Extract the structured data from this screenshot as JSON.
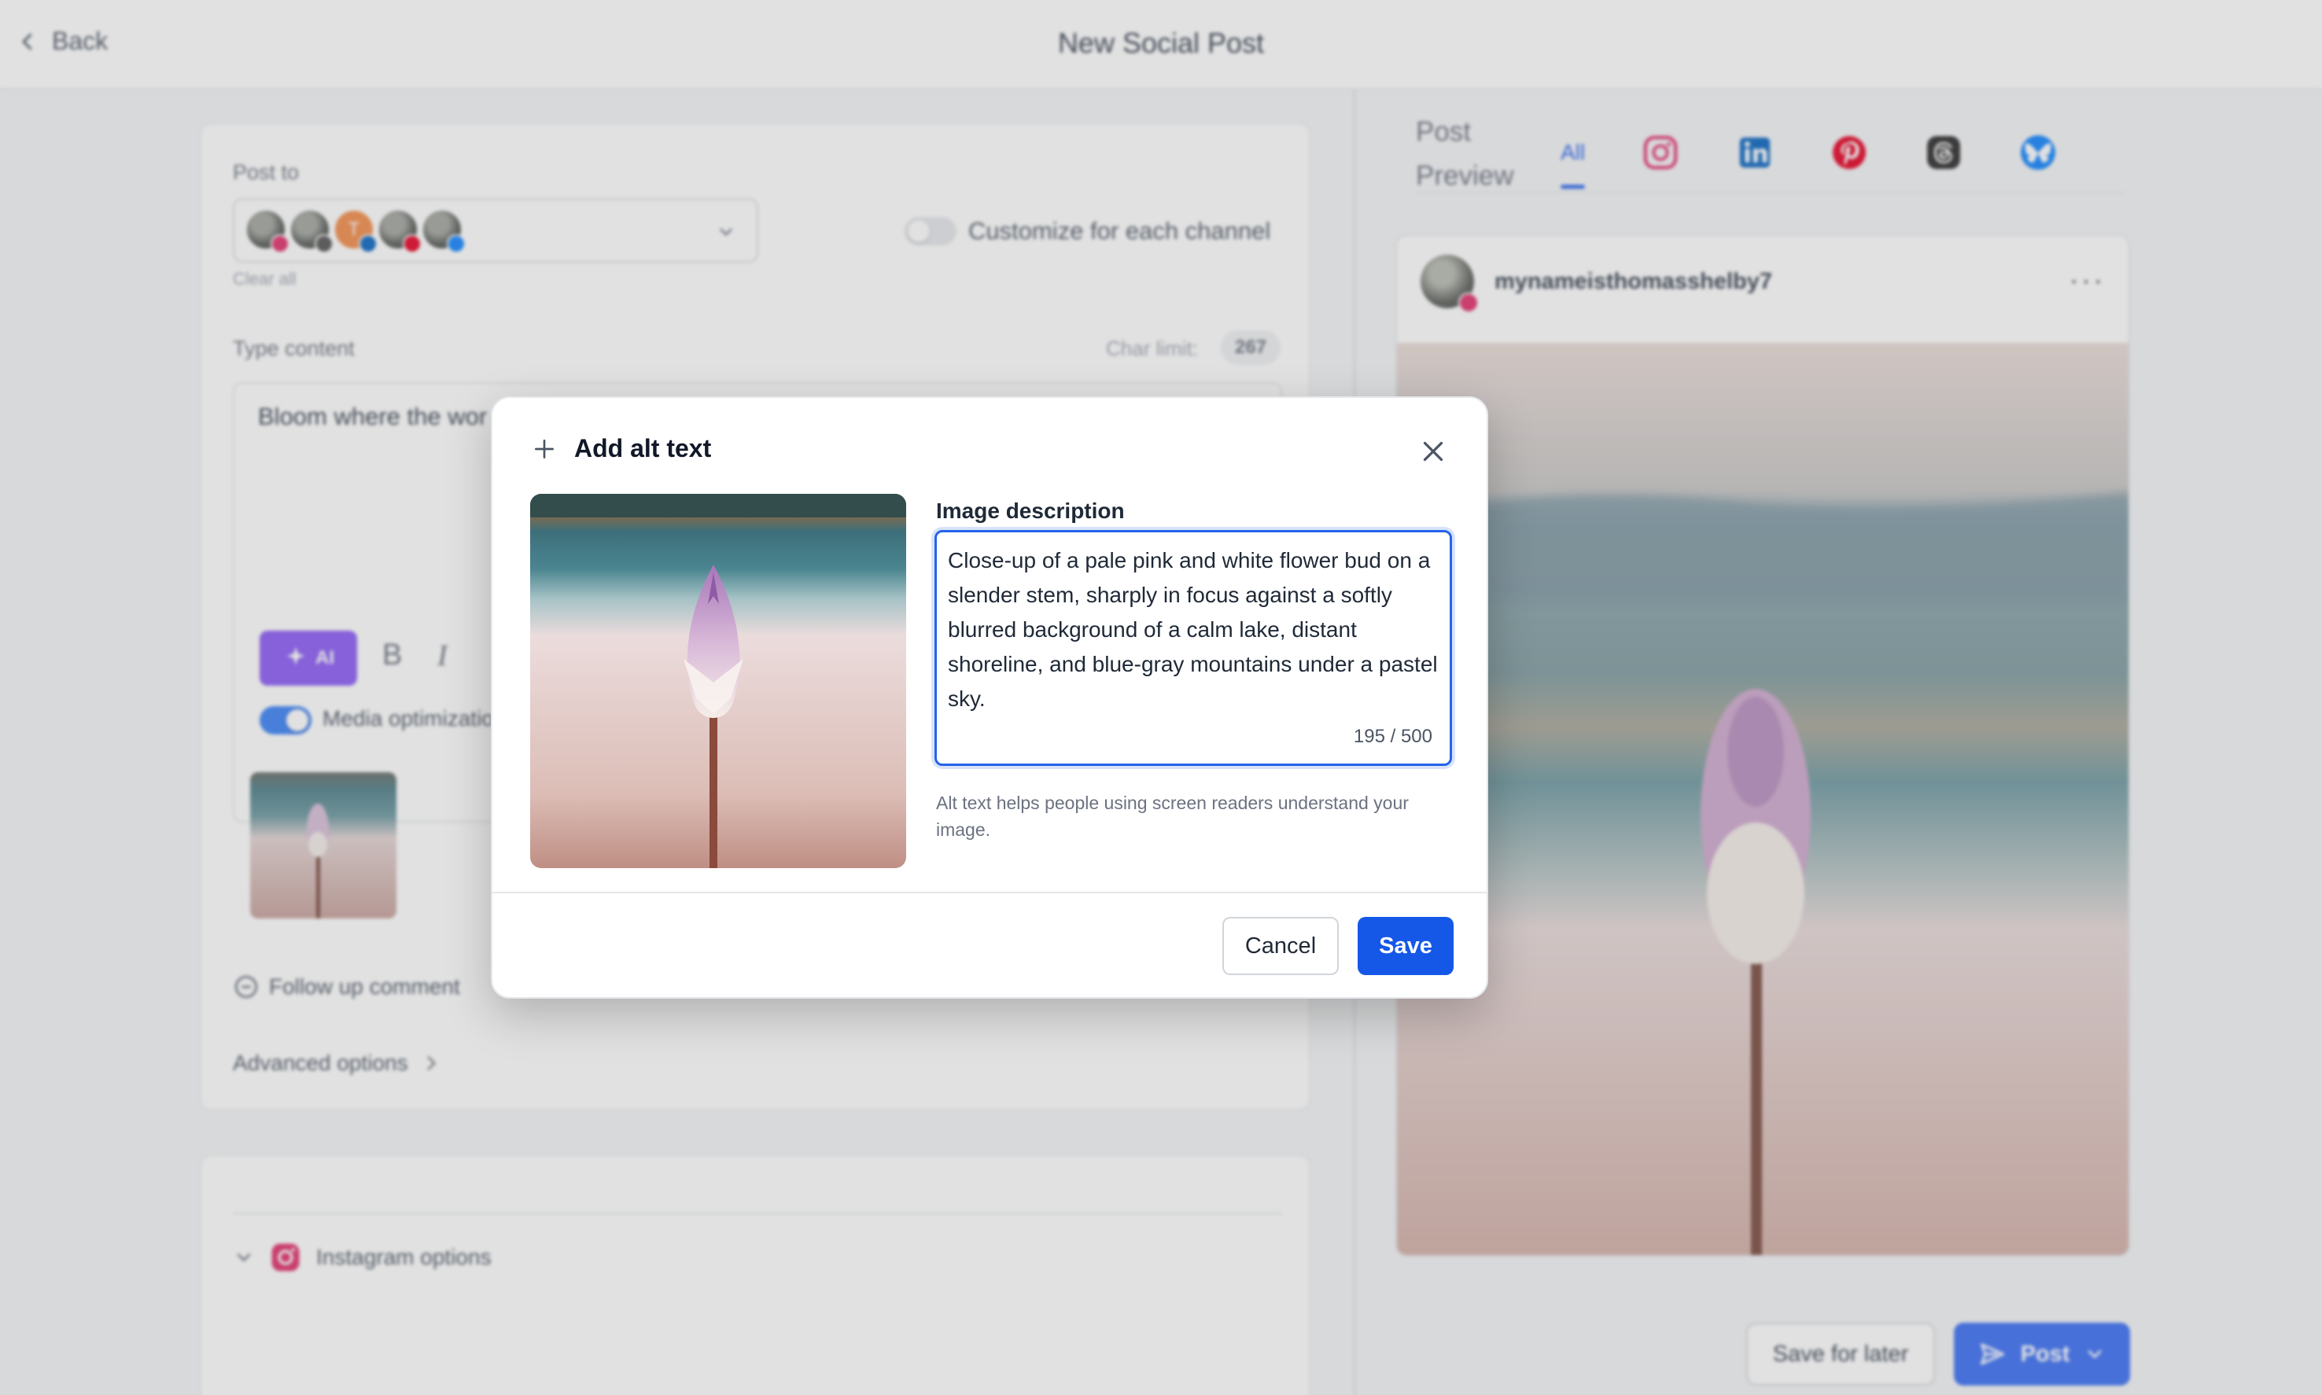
{
  "header": {
    "back_label": "Back",
    "title": "New Social Post"
  },
  "composer": {
    "post_to_label": "Post to",
    "channels": [
      {
        "name": "instagram",
        "badge": "#e1306c"
      },
      {
        "name": "threads",
        "badge": "#555555"
      },
      {
        "name": "linkedin",
        "badge": "#0a66c2",
        "initial": "T"
      },
      {
        "name": "pinterest",
        "badge": "#e60023"
      },
      {
        "name": "bluesky",
        "badge": "#1185fe"
      }
    ],
    "clear_all": "Clear all",
    "customize_label": "Customize for each channel",
    "type_content_label": "Type content",
    "char_limit_label": "Char limit:",
    "char_limit_value": "267",
    "content_text": "Bloom where the wor",
    "ai_label": "AI",
    "bold": "B",
    "italic": "I",
    "media_opt_label": "Media optimizatio",
    "follow_up_label": "Follow up comment",
    "advanced_label": "Advanced options",
    "instagram_options_label": "Instagram options"
  },
  "preview": {
    "title": "Post Preview",
    "tab_all": "All",
    "tabs": [
      "instagram",
      "linkedin",
      "pinterest",
      "threads",
      "bluesky"
    ],
    "username": "mynameisthomasshelby7",
    "more": "···"
  },
  "actions": {
    "save_for_later": "Save for later",
    "post": "Post"
  },
  "modal": {
    "title": "Add alt text",
    "field_label": "Image description",
    "alt_text": "Close-up of a pale pink and white flower bud on a slender stem, sharply in focus against a softly blurred background of a calm lake, distant shoreline, and blue-gray mountains under a pastel sky.",
    "counter": "195 / 500",
    "help": "Alt text helps people using screen readers understand your image.",
    "cancel": "Cancel",
    "save": "Save"
  },
  "colors": {
    "accent": "#1558e8",
    "ai": "#8b5cf6",
    "instagram": "#e1306c",
    "linkedin": "#0a66c2",
    "pinterest": "#e60023",
    "bluesky": "#1185fe"
  }
}
